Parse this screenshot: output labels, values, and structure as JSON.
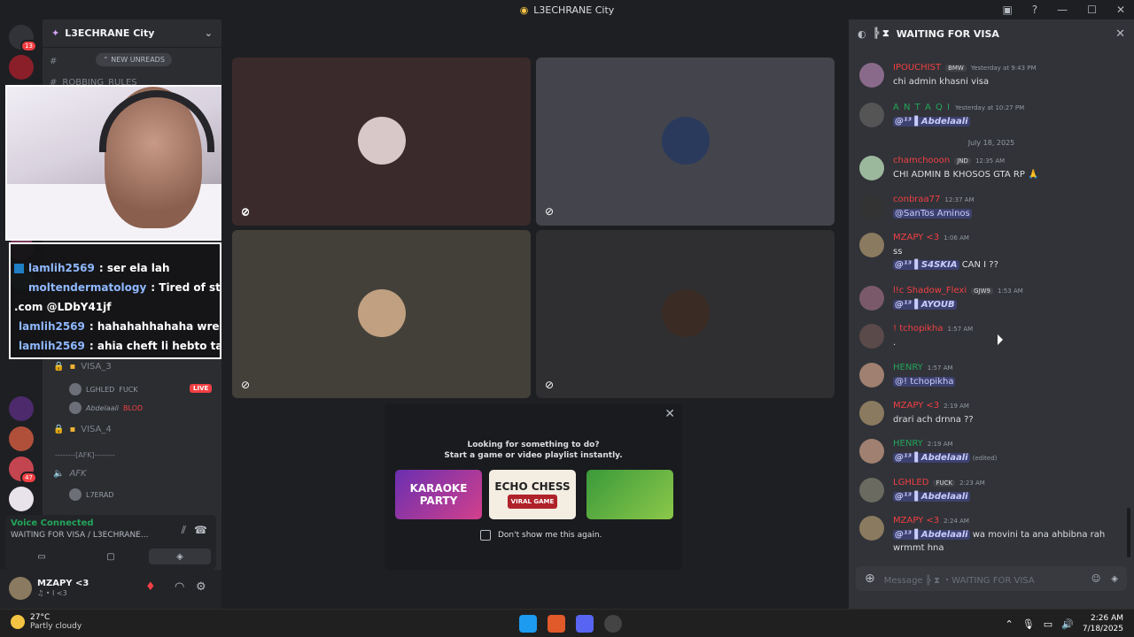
{
  "window": {
    "title": "L3ECHRANE City"
  },
  "guilds": {
    "badges": [
      "13",
      "47",
      "8"
    ]
  },
  "sidebar": {
    "server_name": "L3ECHRANE City",
    "new_unreads": "NEW UNREADS",
    "channel_robbing": "ROBBING_RULES",
    "visa3": "VISA_3",
    "visa4": "VISA_4",
    "afk_separator": "--------[AFK]--------",
    "afk": "AFK",
    "vc_users": [
      {
        "name": "LGHLED",
        "tag": "FUCK",
        "live": "LIVE"
      },
      {
        "name": "Abdelaali",
        "tag": "BLOD"
      }
    ],
    "afk_user": "L7ERAD"
  },
  "stream_chat": [
    {
      "user": "lamlih2569",
      "text": ": ser ela lah"
    },
    {
      "user": "moltendermatology",
      "text": ": Tired of strea"
    },
    {
      "user": "",
      "text": ".com @LDbY41jf"
    },
    {
      "user": "lamlih2569",
      "text": ": hahahahhahaha wrem"
    },
    {
      "user": "lamlih2569",
      "text": ": ahia cheft li hebto tay"
    }
  ],
  "voice": {
    "connected": "Voice Connected",
    "channel": "WAITING FOR VISA / L3ECHRANE..."
  },
  "user": {
    "name": "MZAPY <3",
    "status": "♫ • I <3"
  },
  "activity": {
    "line1": "Looking for something to do?",
    "line2": "Start a game or video playlist instantly.",
    "games": [
      "KARAOKE PARTY",
      "ECHO CHESS",
      "VIRAL GAME"
    ],
    "dont_show": "Don't show me this again."
  },
  "chat": {
    "channel": "WAITING FOR VISA",
    "day_separator": "July 18, 2025",
    "messages": [
      {
        "name": "IPOUCHIST",
        "name_color": "#f23f43",
        "tag": "BMW",
        "time": "Yesterday at 9:43 PM",
        "body": "chi admin khasni visa"
      },
      {
        "name": "A N T A Q I",
        "name_color": "#23a55a",
        "tag": "",
        "time": "Yesterday at 10:27 PM",
        "mention": "@¹³ ▌Abdelaali",
        "body": ""
      },
      {
        "name": "chamchooon",
        "name_color": "#f23f43",
        "tag": "JND",
        "time": "12:35 AM",
        "body": "CHI ADMIN B KHOSOS GTA RP 🙏"
      },
      {
        "name": "conbraa77",
        "name_color": "#f23f43",
        "tag": "",
        "time": "12:37 AM",
        "mention": "@SanTos Aminos",
        "body": ""
      },
      {
        "name": "MZAPY <3",
        "name_color": "#f23f43",
        "tag": "",
        "time": "1:06 AM",
        "body": "ss",
        "mention": "@¹³ ▌S4SKIA",
        "body2": " CAN I ??"
      },
      {
        "name": "l!c Shadow_Flexi",
        "name_color": "#f23f43",
        "tag": "GJW9",
        "time": "1:53 AM",
        "mention": "@¹³ ▌AYOUB",
        "body": ""
      },
      {
        "name": "! tchopikha",
        "name_color": "#f23f43",
        "tag": "",
        "time": "1:57 AM",
        "body": "."
      },
      {
        "name": "HENRY",
        "name_color": "#23a55a",
        "tag": "",
        "time": "1:57 AM",
        "mention": "@! tchopikha",
        "body": ""
      },
      {
        "name": "MZAPY <3",
        "name_color": "#f23f43",
        "tag": "",
        "time": "2:19 AM",
        "body": "drari ach drnna ??"
      },
      {
        "name": "HENRY",
        "name_color": "#23a55a",
        "tag": "",
        "time": "2:19 AM",
        "mention": "@¹³ ▌Abdelaali",
        "edited": "(edited)",
        "body": ""
      },
      {
        "name": "LGHLED",
        "name_color": "#f23f43",
        "tag": "FUCK",
        "time": "2:23 AM",
        "mention": "@¹³ ▌Abdelaali",
        "body": ""
      },
      {
        "name": "MZAPY <3",
        "name_color": "#f23f43",
        "tag": "",
        "time": "2:24 AM",
        "mention": "@¹³ ▌Abdelaali",
        "body": " wa movini ta ana ahbibna rah",
        "body3": "wrmmt hna"
      }
    ],
    "composer_placeholder": "Message ╠ ⧗ ・WAITING FOR VISA"
  },
  "taskbar": {
    "temp": "27°C",
    "weather": "Partly cloudy",
    "time": "2:26 AM",
    "date": "7/18/2025"
  },
  "colors": {
    "green": "#23a55a",
    "red": "#f23f43",
    "blurple": "#5865f2"
  }
}
